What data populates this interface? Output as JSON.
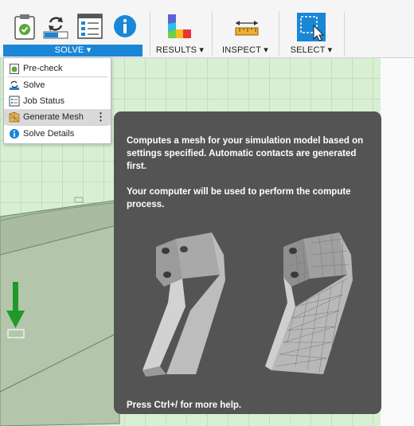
{
  "toolbar": {
    "groups": {
      "solve": "SOLVE",
      "results": "RESULTS",
      "inspect": "INSPECT",
      "select": "SELECT"
    },
    "icons": [
      "clipboard-check-icon",
      "refresh-icon",
      "job-status-icon",
      "info-icon",
      "results-icon",
      "ruler-icon",
      "select-icon"
    ],
    "colors": {
      "accent": "#1a86d6"
    }
  },
  "dropdown": {
    "items": [
      {
        "label": "Pre-check",
        "icon": "precheck-icon"
      },
      {
        "label": "Solve",
        "icon": "solve-icon"
      },
      {
        "label": "Job Status",
        "icon": "job-status-icon"
      },
      {
        "label": "Generate Mesh",
        "icon": "generate-mesh-icon",
        "highlighted": true
      },
      {
        "label": "Solve Details",
        "icon": "info-icon"
      }
    ]
  },
  "tooltip": {
    "description": "Computes a mesh for your simulation model based on settings specified. Automatic contacts are generated first.",
    "compute_note": "Your computer will be used to perform the compute process.",
    "help_hint": "Press Ctrl+/ for more help."
  }
}
